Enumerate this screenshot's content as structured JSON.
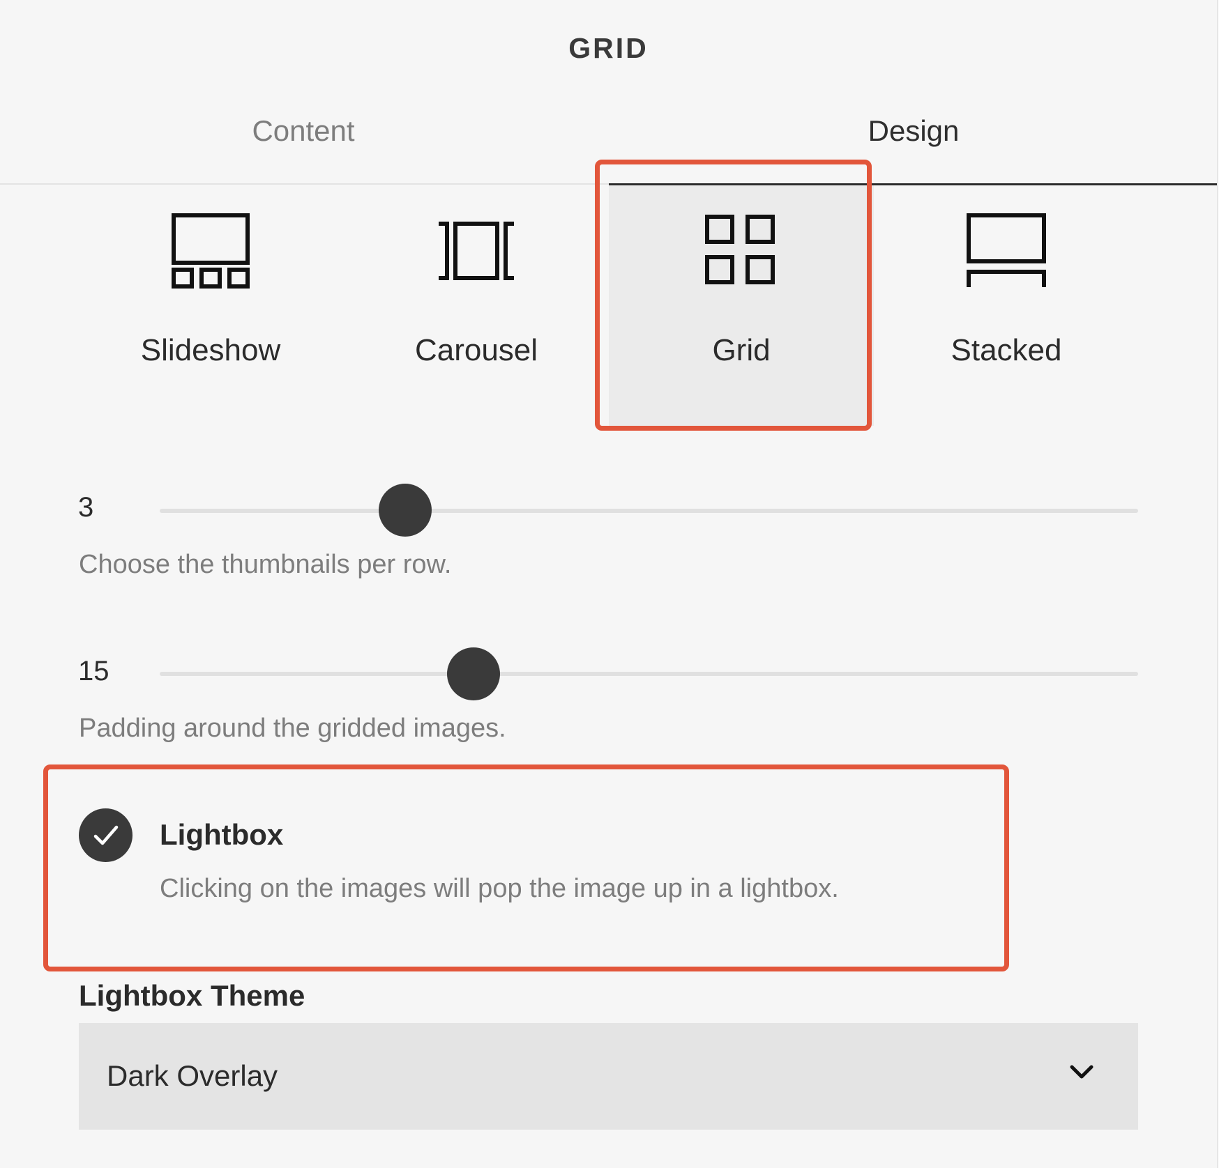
{
  "header": {
    "title": "GRID"
  },
  "tabs": [
    {
      "label": "Content",
      "active": false
    },
    {
      "label": "Design",
      "active": true
    }
  ],
  "layouts": {
    "selected": "Grid",
    "options": [
      {
        "label": "Slideshow",
        "icon": "slideshow-icon"
      },
      {
        "label": "Carousel",
        "icon": "carousel-icon"
      },
      {
        "label": "Grid",
        "icon": "grid-icon"
      },
      {
        "label": "Stacked",
        "icon": "stacked-icon"
      }
    ]
  },
  "thumbnails_per_row": {
    "value": "3",
    "help": "Choose the thumbnails per row."
  },
  "padding": {
    "value": "15",
    "help": "Padding around the gridded images."
  },
  "lightbox": {
    "checked": true,
    "title": "Lightbox",
    "description": "Clicking on the images will pop the image up in a lightbox."
  },
  "lightbox_theme": {
    "label": "Lightbox Theme",
    "selected": "Dark Overlay"
  },
  "colors": {
    "highlight": "#e2563b",
    "thumb": "#3a3a3a",
    "background": "#f6f6f6"
  }
}
